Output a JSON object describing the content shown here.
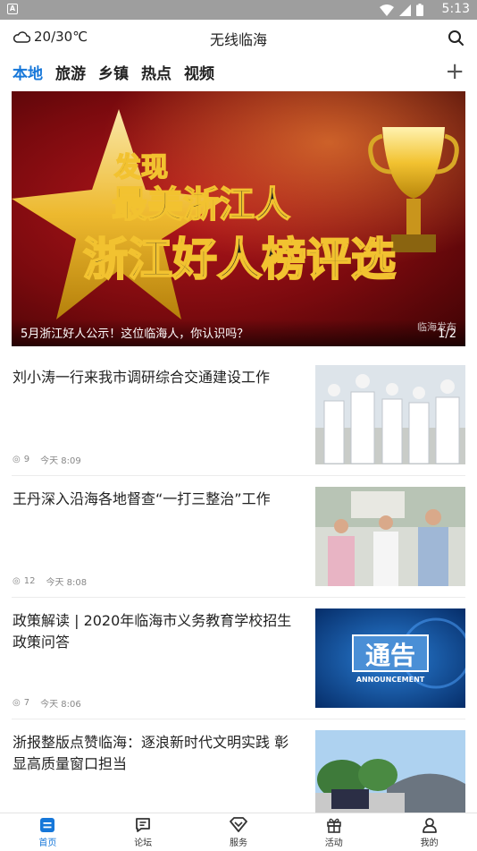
{
  "status_bar": {
    "time": "5:13",
    "notification_icon": "A"
  },
  "header": {
    "weather": "20/30℃",
    "title": "无线临海"
  },
  "tabs": [
    {
      "label": "本地",
      "active": true
    },
    {
      "label": "旅游"
    },
    {
      "label": "乡镇"
    },
    {
      "label": "热点"
    },
    {
      "label": "视频"
    }
  ],
  "banner": {
    "line1": "发现",
    "line2": "最美浙江人",
    "line3": "浙江好人榜评选",
    "caption": "5月浙江好人公示！这位临海人，你认识吗？",
    "watermark": "临海发布",
    "pager": "1/2"
  },
  "news": [
    {
      "title": "刘小涛一行来我市调研综合交通建设工作",
      "views": "9",
      "time": "今天 8:09"
    },
    {
      "title": "王丹深入沿海各地督查“一打三整治”工作",
      "views": "12",
      "time": "今天 8:08"
    },
    {
      "title": "政策解读 | 2020年临海市义务教育学校招生政策问答",
      "views": "7",
      "time": "今天 8:06",
      "thumb_title": "通告",
      "thumb_sub": "ANNOUNCEMENT"
    },
    {
      "title": "浙报整版点赞临海：逐浪新时代文明实践 彰显高质量窗口担当",
      "views": "",
      "time": ""
    }
  ],
  "bottom_nav": [
    {
      "label": "首页",
      "active": true,
      "icon": "home-icon"
    },
    {
      "label": "论坛",
      "icon": "forum-icon"
    },
    {
      "label": "服务",
      "icon": "service-icon"
    },
    {
      "label": "活动",
      "icon": "gift-icon"
    },
    {
      "label": "我的",
      "icon": "user-icon"
    }
  ],
  "colors": {
    "accent": "#1677d9",
    "banner_red": "#b5161c",
    "gold": "#f2c230"
  }
}
